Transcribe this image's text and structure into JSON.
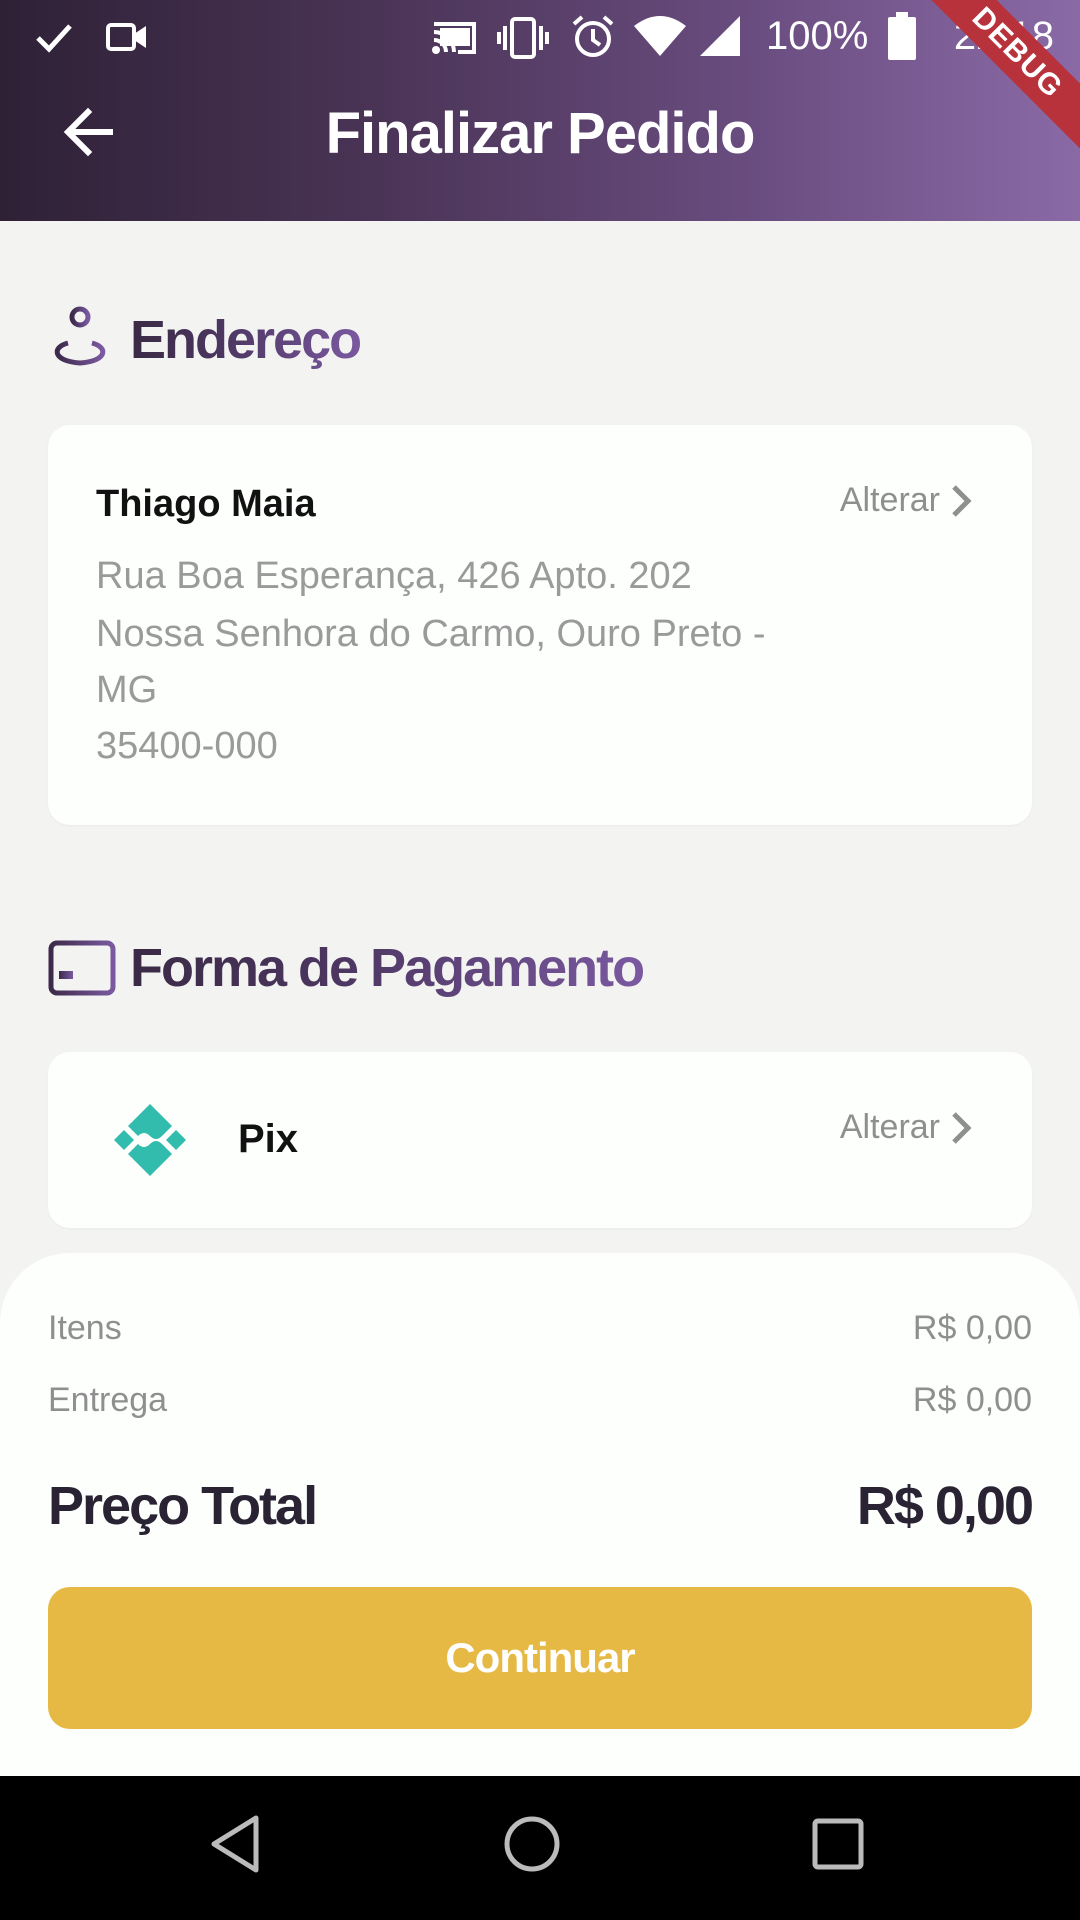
{
  "status_bar": {
    "battery_percent": "100%",
    "time": "22:18",
    "debug_label": "DEBUG",
    "icons": [
      "check-icon",
      "video-icon",
      "cast-icon",
      "vibrate-icon",
      "alarm-icon",
      "wifi-icon",
      "signal-icon",
      "battery-icon"
    ]
  },
  "app_bar": {
    "title": "Finalizar Pedido",
    "back_icon": "arrow-back-icon"
  },
  "address_section": {
    "title": "Endereço",
    "icon": "location-pin-icon",
    "name": "Thiago Maia",
    "lines": [
      "Rua Boa Esperança, 426 Apto. 202",
      "Nossa Senhora do Carmo, Ouro Preto -",
      "MG",
      "35400-000"
    ],
    "change_label": "Alterar"
  },
  "payment_section": {
    "title": "Forma de Pagamento",
    "icon": "credit-card-icon",
    "method": "Pix",
    "method_icon": "pix-logo-icon",
    "change_label": "Alterar"
  },
  "summary": {
    "items_label": "Itens",
    "items_value": "R$ 0,00",
    "delivery_label": "Entrega",
    "delivery_value": "R$ 0,00",
    "total_label": "Preço Total",
    "total_value": "R$ 0,00",
    "continue_label": "Continuar"
  },
  "colors": {
    "accent": "#e5b944",
    "header_gradient_start": "#2e2136",
    "header_gradient_end": "#8a6aa6",
    "pix": "#32bcad"
  },
  "nav_bar": {
    "icons": [
      "nav-back-icon",
      "nav-home-icon",
      "nav-recents-icon"
    ]
  }
}
